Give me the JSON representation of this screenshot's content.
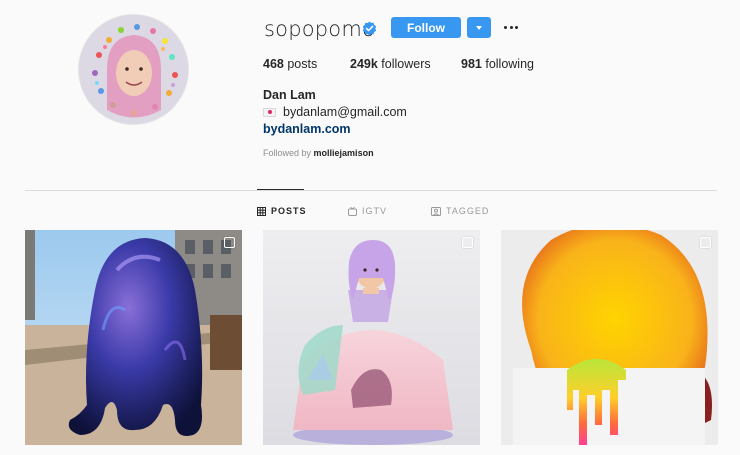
{
  "profile": {
    "username": "sopopomo",
    "verified": true,
    "follow_label": "Follow",
    "stats": {
      "posts": {
        "count": "468",
        "label": "posts"
      },
      "followers": {
        "count": "249k",
        "label": "followers"
      },
      "following": {
        "count": "981",
        "label": "following"
      }
    },
    "full_name": "Dan Lam",
    "bio_email": "bydanlam@gmail.com",
    "website": "bydanlam.com",
    "followed_by_prefix": "Followed by",
    "followed_by_user": "molliejamison"
  },
  "tabs": [
    {
      "label": "POSTS",
      "icon": "grid-icon",
      "active": true
    },
    {
      "label": "IGTV",
      "icon": "igtv-icon",
      "active": false
    },
    {
      "label": "TAGGED",
      "icon": "tagged-icon",
      "active": false
    }
  ],
  "posts": [
    {
      "kind": "photo",
      "subject": "iridescent-blob-sculpture",
      "multi": true
    },
    {
      "kind": "photo",
      "subject": "doll-sculpture",
      "multi": true
    },
    {
      "kind": "photo",
      "subject": "dripping-sculpture",
      "multi": true
    }
  ],
  "colors": {
    "accent": "#3897f0",
    "link": "#003569",
    "muted": "#8e8e8e",
    "text": "#262626",
    "background": "#fafafa",
    "divider": "#dbdbdb"
  }
}
